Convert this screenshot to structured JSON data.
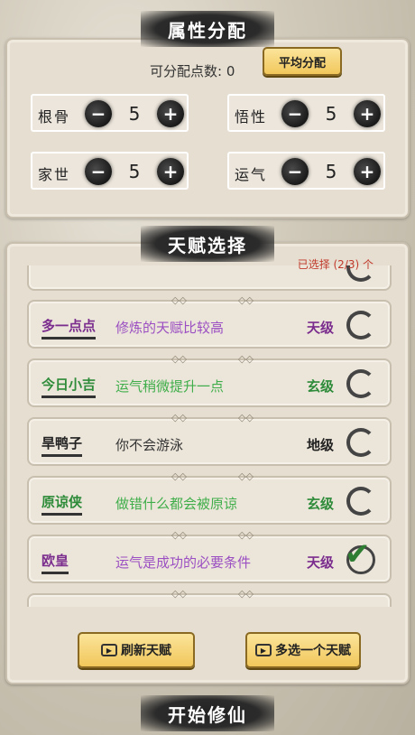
{
  "attr_title": "属性分配",
  "points_label": "可分配点数: 0",
  "avg_button": "平均分配",
  "attributes": [
    {
      "name": "根骨",
      "value": "5"
    },
    {
      "name": "悟性",
      "value": "5"
    },
    {
      "name": "家世",
      "value": "5"
    },
    {
      "name": "运气",
      "value": "5"
    }
  ],
  "minus_symbol": "−",
  "plus_symbol": "+",
  "talent_title": "天赋选择",
  "selected_text": "已选择 (2/3) 个",
  "talents": [
    {
      "name": "多一点点",
      "desc": "修炼的天赋比较高",
      "grade": "天级",
      "name_color": "#7b2d8e",
      "desc_color": "#9b4fc2",
      "selected": false
    },
    {
      "name": "今日小吉",
      "desc": "运气稍微提升一点",
      "grade": "玄级",
      "name_color": "#2e8b3a",
      "desc_color": "#3fae4a",
      "selected": false
    },
    {
      "name": "旱鸭子",
      "desc": "你不会游泳",
      "grade": "地级",
      "name_color": "#222222",
      "desc_color": "#333333",
      "selected": false
    },
    {
      "name": "原谅侠",
      "desc": "做错什么都会被原谅",
      "grade": "玄级",
      "name_color": "#2e8b3a",
      "desc_color": "#3fae4a",
      "selected": false
    },
    {
      "name": "欧皇",
      "desc": "运气是成功的必要条件",
      "grade": "天级",
      "name_color": "#7b2d8e",
      "desc_color": "#9b4fc2",
      "selected": true
    }
  ],
  "row_deco": "◇◇",
  "check_symbol": "✔",
  "refresh_button": "刷新天赋",
  "extra_button": "多选一个天赋",
  "video_symbol": "▶",
  "start_button": "开始修仙"
}
